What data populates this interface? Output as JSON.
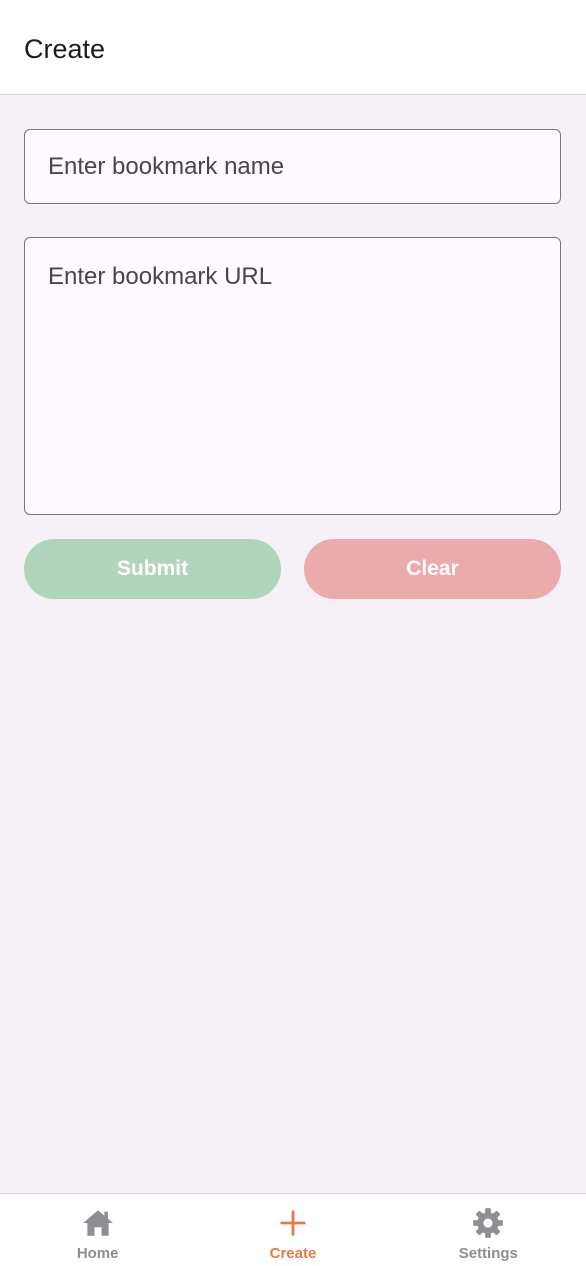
{
  "header": {
    "title": "Create"
  },
  "form": {
    "name_placeholder": "Enter bookmark name",
    "name_value": "",
    "url_placeholder": "Enter bookmark URL",
    "url_value": "",
    "submit_label": "Submit",
    "clear_label": "Clear"
  },
  "tabbar": {
    "tabs": [
      {
        "label": "Home",
        "icon": "home-icon",
        "active": false
      },
      {
        "label": "Create",
        "icon": "plus-icon",
        "active": true
      },
      {
        "label": "Settings",
        "icon": "gear-icon",
        "active": false
      }
    ]
  },
  "colors": {
    "accent": "#e8794a",
    "submit": "#b1d5bc",
    "clear": "#ecabab",
    "background": "#f6f1f7",
    "inactive_tab": "#8e8e93"
  }
}
